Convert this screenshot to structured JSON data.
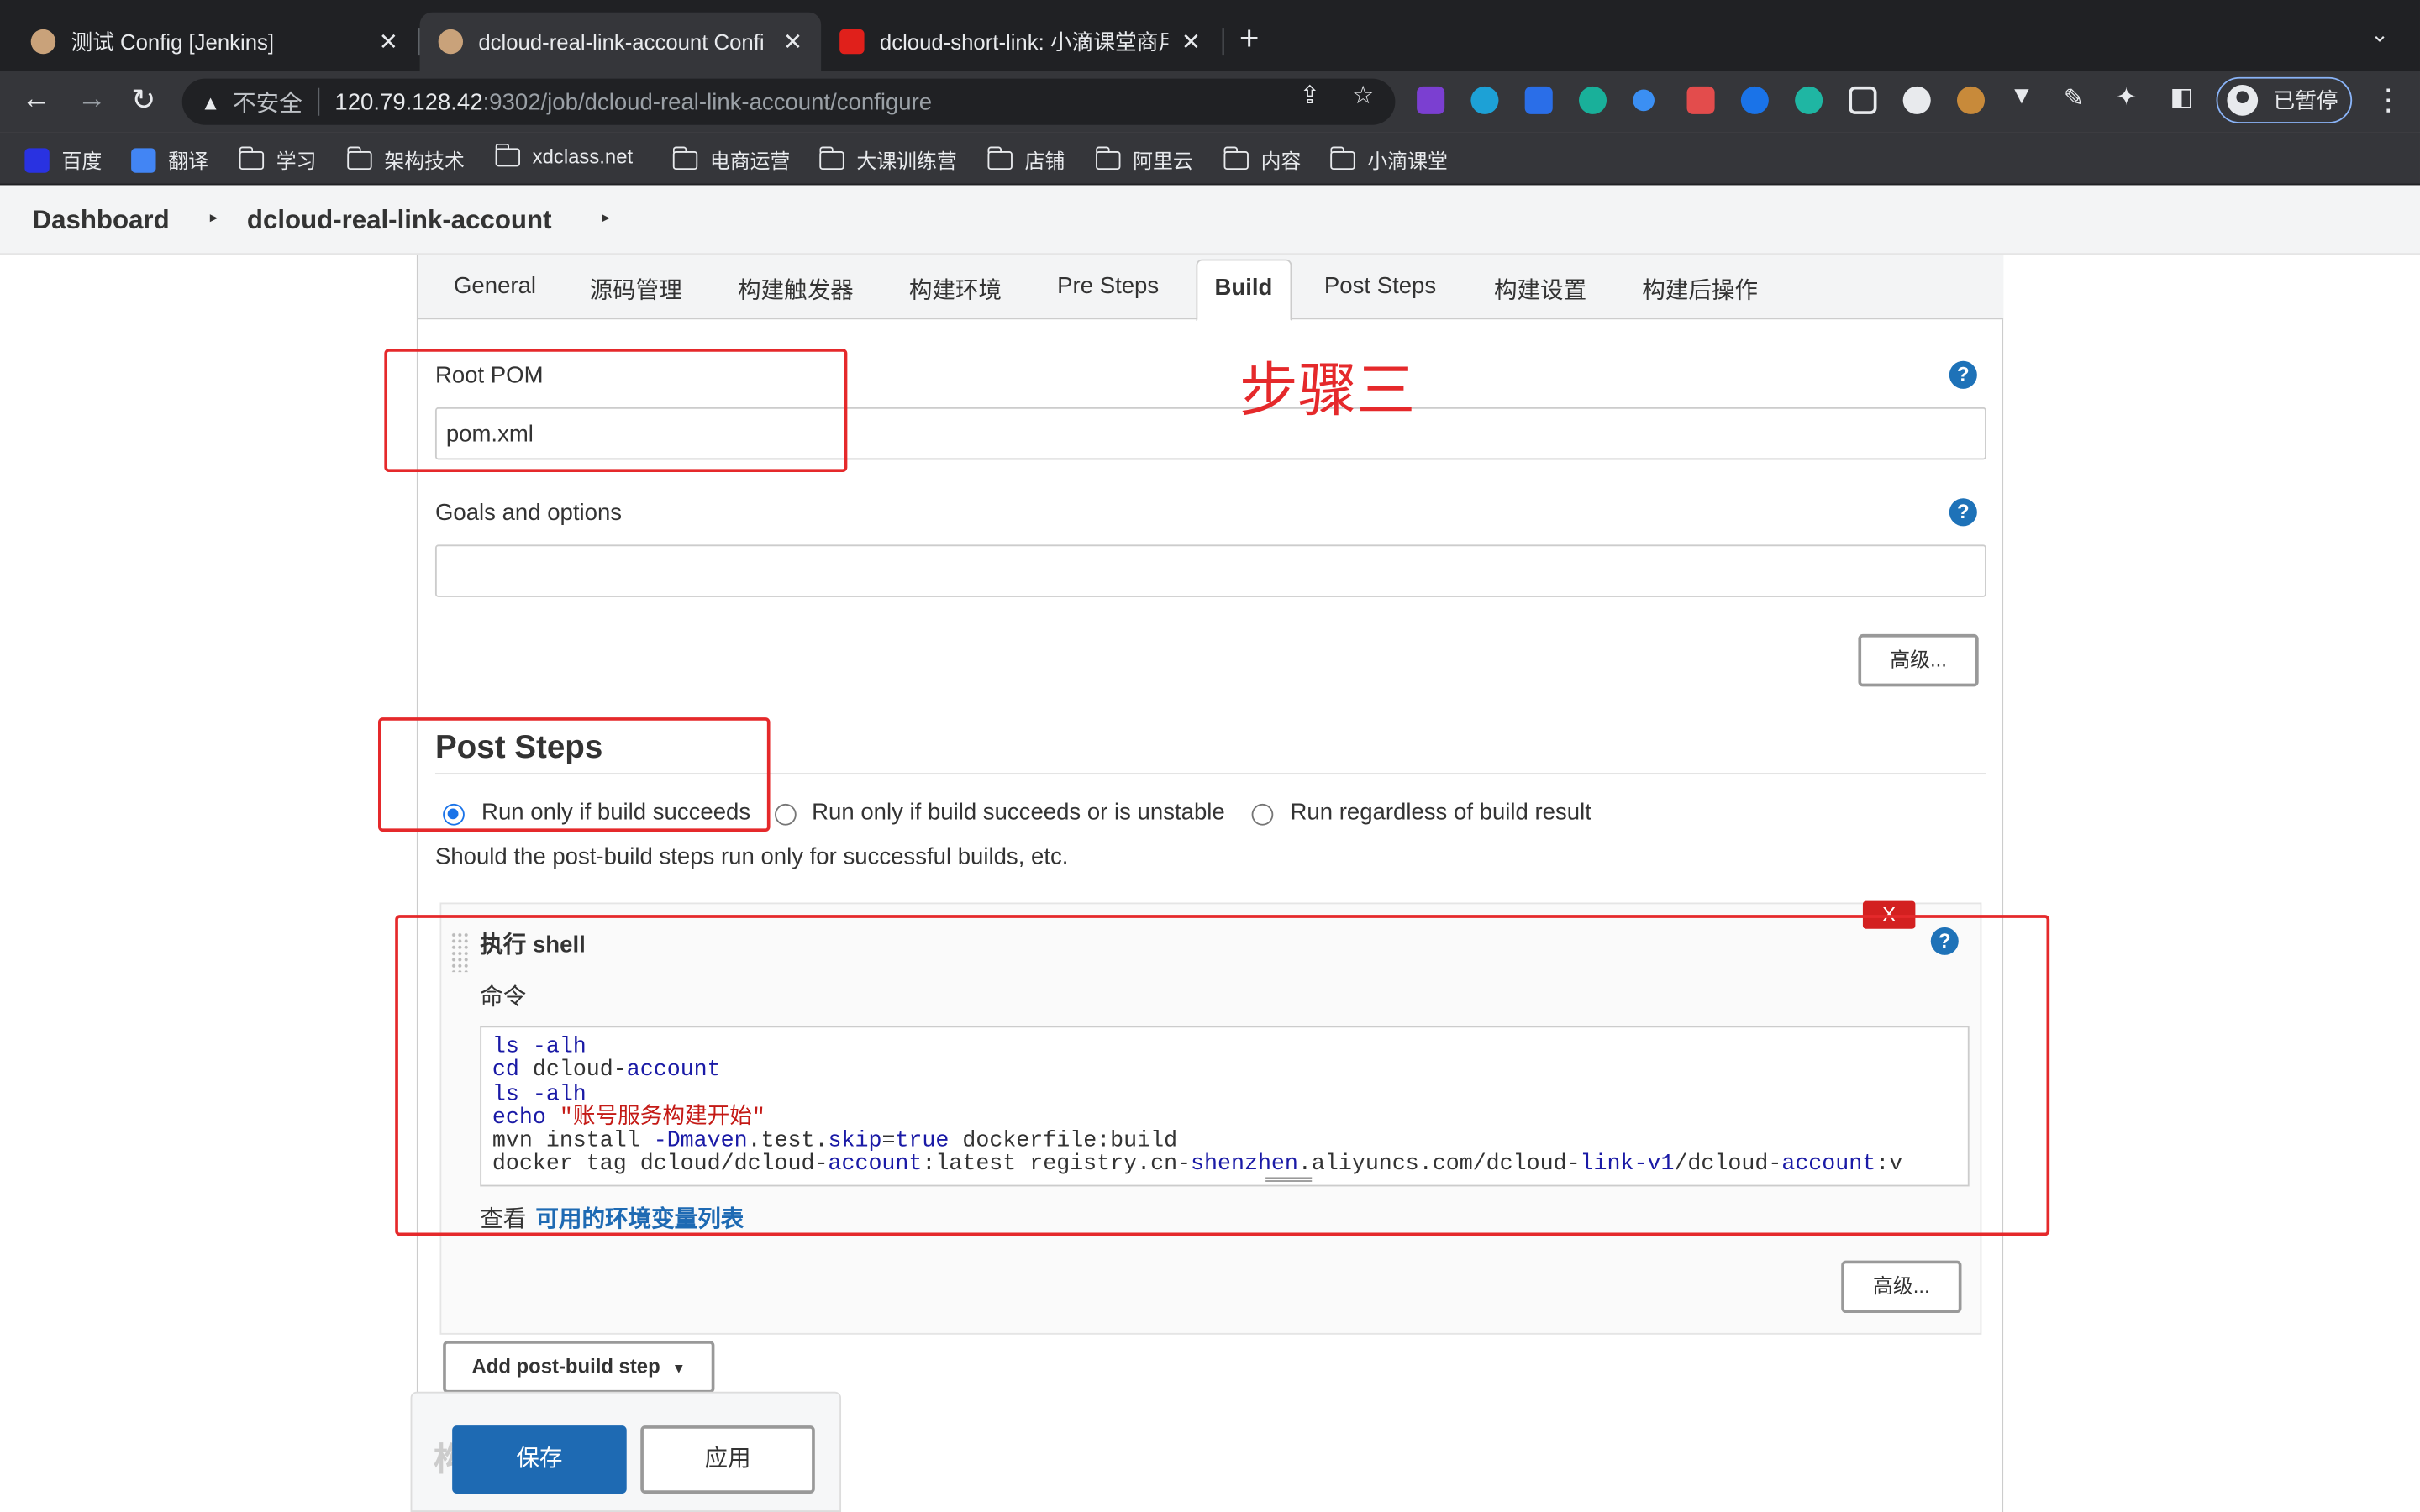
{
  "browser": {
    "tabs": [
      {
        "title": "测试 Config [Jenkins]"
      },
      {
        "title": "dcloud-real-link-account Confi"
      },
      {
        "title": "dcloud-short-link: 小滴课堂商用"
      }
    ],
    "new_tab": "+",
    "tab_search": "⌄",
    "nav": {
      "back": "←",
      "forward": "→",
      "reload": "↻"
    },
    "omnibox": {
      "warning_icon": "warning-icon",
      "insecure_label": "不安全",
      "host": "120.79.128.42",
      "path": ":9302/job/dcloud-real-link-account/configure"
    },
    "profile_label": "已暂停",
    "menu_icon": "⋮",
    "bookmarks": [
      {
        "label": "百度",
        "icon": "baidu-icon"
      },
      {
        "label": "翻译",
        "icon": "translate-icon"
      },
      {
        "label": "学习",
        "icon": "folder-icon"
      },
      {
        "label": "架构技术",
        "icon": "folder-icon"
      },
      {
        "label": "xdclass.net",
        "icon": "folder-icon"
      },
      {
        "label": "电商运营",
        "icon": "folder-icon"
      },
      {
        "label": "大课训练营",
        "icon": "folder-icon"
      },
      {
        "label": "店铺",
        "icon": "folder-icon"
      },
      {
        "label": "阿里云",
        "icon": "folder-icon"
      },
      {
        "label": "内容",
        "icon": "folder-icon"
      },
      {
        "label": "小滴课堂",
        "icon": "folder-icon"
      }
    ]
  },
  "breadcrumb": {
    "items": [
      "Dashboard",
      "dcloud-real-link-account"
    ],
    "separator": "▸"
  },
  "config_tabs": [
    "General",
    "源码管理",
    "构建触发器",
    "构建环境",
    "Pre Steps",
    "Build",
    "Post Steps",
    "构建设置",
    "构建后操作"
  ],
  "active_tab": "Build",
  "build": {
    "root_pom_label": "Root POM",
    "root_pom_value": "pom.xml",
    "goals_label": "Goals and options",
    "goals_value": "",
    "advanced_button": "高级..."
  },
  "annotation": "步骤三",
  "post_steps": {
    "title": "Post Steps",
    "options": [
      {
        "label": "Run only if build succeeds",
        "selected": true
      },
      {
        "label": "Run only if build succeeds or is unstable",
        "selected": false
      },
      {
        "label": "Run regardless of build result",
        "selected": false
      }
    ],
    "description": "Should the post-build steps run only for successful builds, etc.",
    "shell_step": {
      "title": "执行 shell",
      "delete_label": "X",
      "command_label": "命令",
      "command_lines": [
        "ls -alh",
        "cd dcloud-account",
        "ls -alh",
        "echo \"账号服务构建开始\"",
        "mvn install -Dmaven.test.skip=true dockerfile:build",
        "docker tag dcloud/dcloud-account:latest registry.cn-shenzhen.aliyuncs.com/dcloud-link-v1/dcloud-account:v"
      ],
      "env_prefix": "查看",
      "env_link": "可用的环境变量列表",
      "advanced_button": "高级..."
    },
    "add_button": "Add post-build step"
  },
  "footer": {
    "save_label": "保存",
    "apply_label": "应用",
    "partial_heading": "构"
  },
  "help_glyph": "?",
  "colors": {
    "accent": "#1e6ab3",
    "annotation_red": "#e5292b",
    "help_blue": "#1e72b8"
  }
}
